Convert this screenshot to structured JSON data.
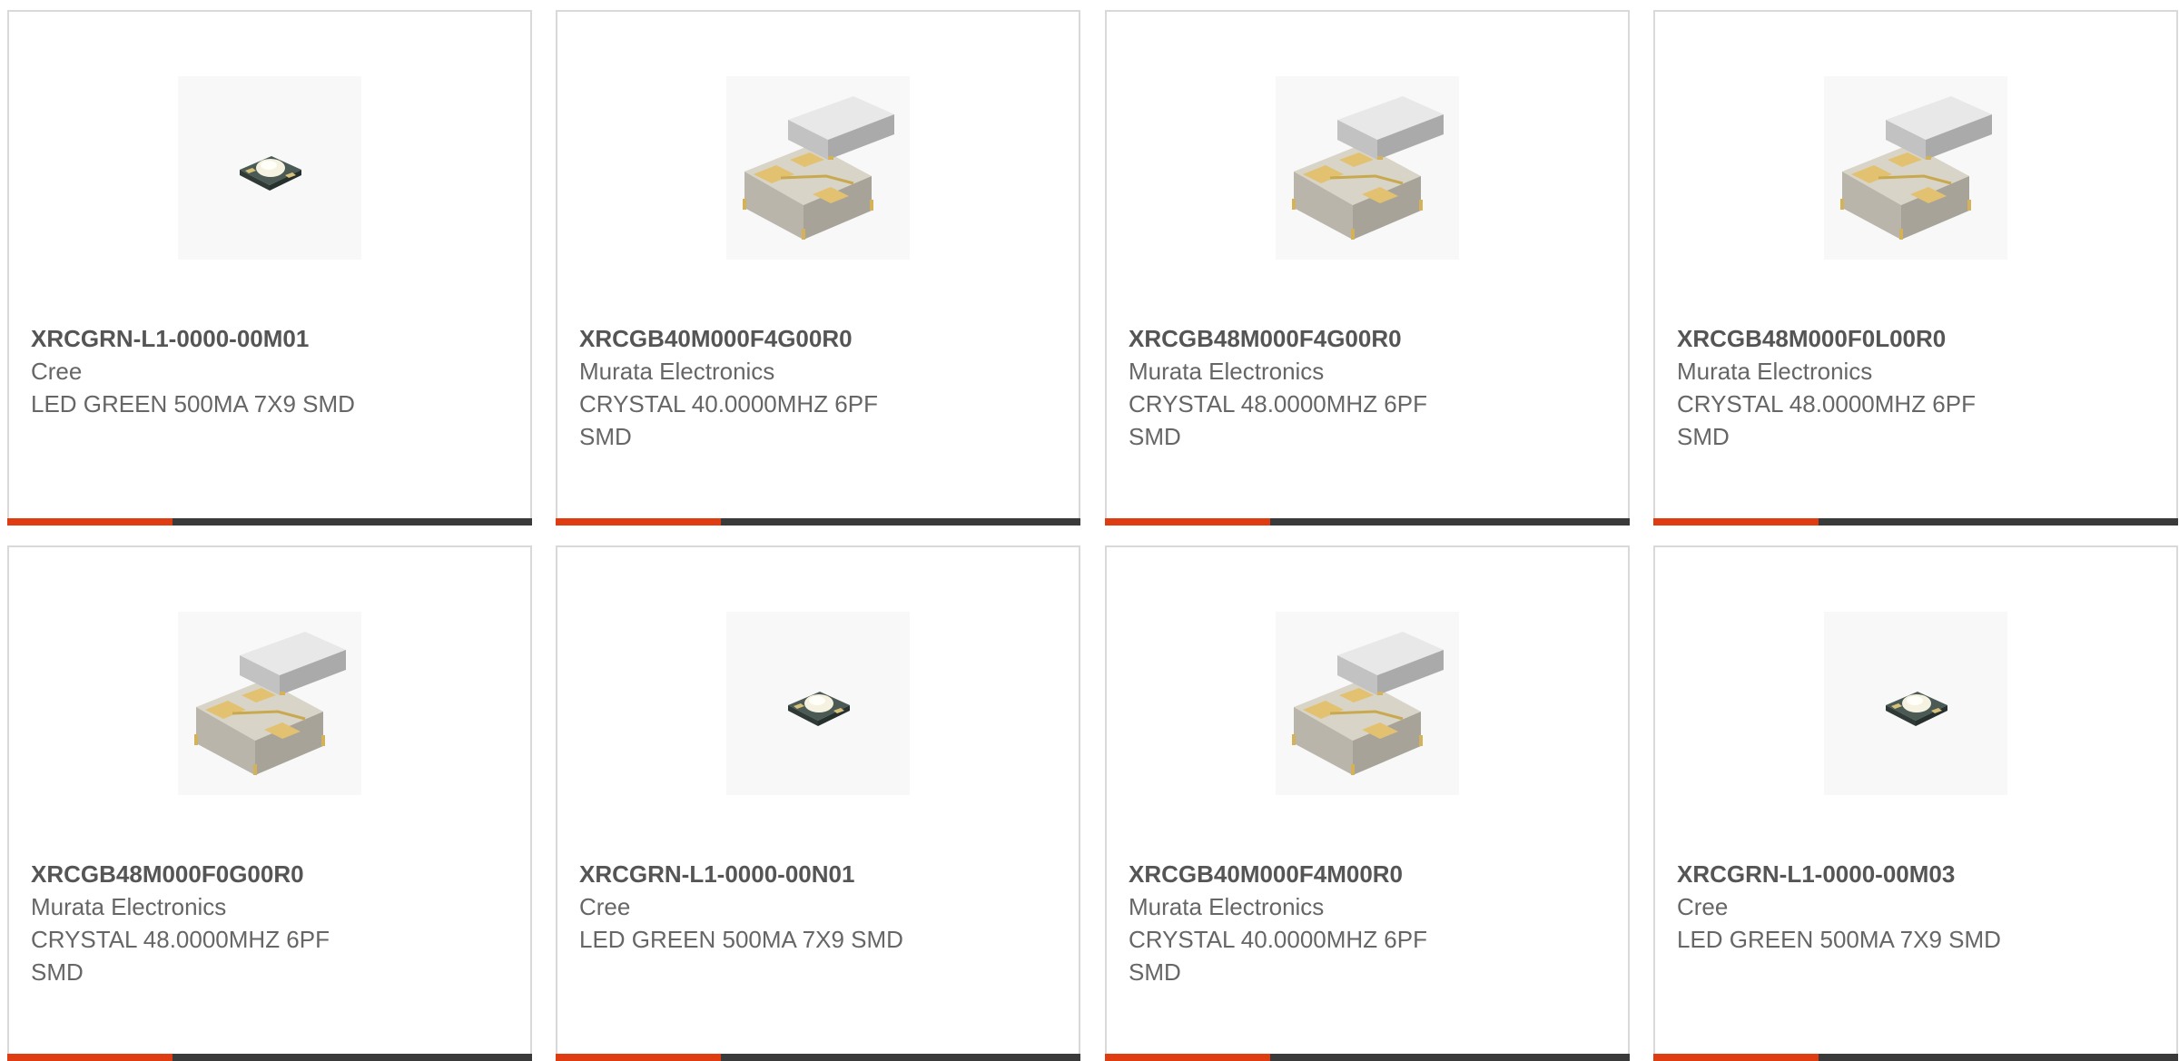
{
  "accent_color": "#e03c12",
  "bar_color": "#3a3a3a",
  "products": [
    {
      "part_number": "XRCGRN-L1-0000-00M01",
      "manufacturer": "Cree",
      "description": "LED GREEN 500MA 7X9 SMD",
      "image": "led-icon"
    },
    {
      "part_number": "XRCGB40M000F4G00R0",
      "manufacturer": "Murata Electronics",
      "description": "CRYSTAL 40.0000MHZ 6PF SMD",
      "image": "crystal-icon"
    },
    {
      "part_number": "XRCGB48M000F4G00R0",
      "manufacturer": "Murata Electronics",
      "description": "CRYSTAL 48.0000MHZ 6PF SMD",
      "image": "crystal-icon"
    },
    {
      "part_number": "XRCGB48M000F0L00R0",
      "manufacturer": "Murata Electronics",
      "description": "CRYSTAL 48.0000MHZ 6PF SMD",
      "image": "crystal-icon"
    },
    {
      "part_number": "XRCGB48M000F0G00R0",
      "manufacturer": "Murata Electronics",
      "description": "CRYSTAL 48.0000MHZ 6PF SMD",
      "image": "crystal-icon"
    },
    {
      "part_number": "XRCGRN-L1-0000-00N01",
      "manufacturer": "Cree",
      "description": "LED GREEN 500MA 7X9 SMD",
      "image": "led-icon"
    },
    {
      "part_number": "XRCGB40M000F4M00R0",
      "manufacturer": "Murata Electronics",
      "description": "CRYSTAL 40.0000MHZ 6PF SMD",
      "image": "crystal-icon"
    },
    {
      "part_number": "XRCGRN-L1-0000-00M03",
      "manufacturer": "Cree",
      "description": "LED GREEN 500MA 7X9 SMD",
      "image": "led-icon"
    }
  ]
}
